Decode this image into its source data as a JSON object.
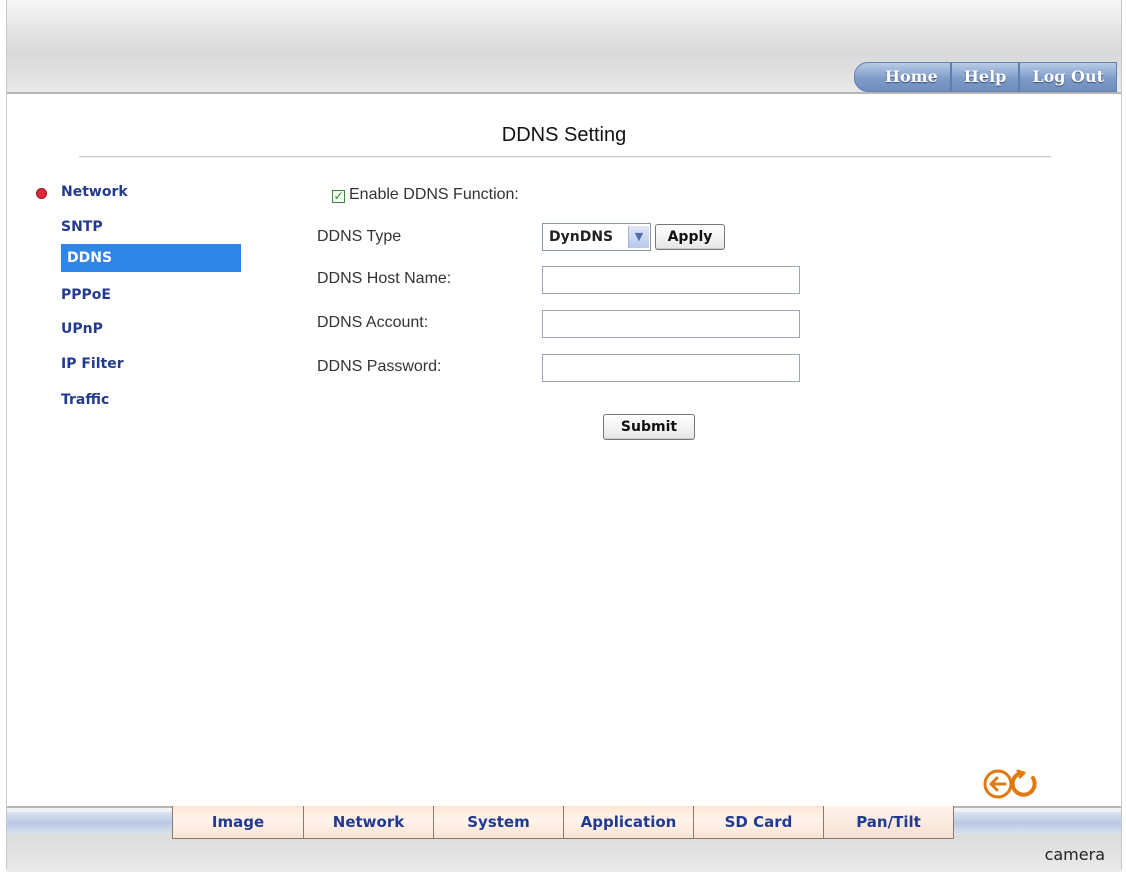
{
  "header": {
    "nav": [
      "Home",
      "Help",
      "Log Out"
    ]
  },
  "page": {
    "title": "DDNS Setting"
  },
  "sidebar": {
    "items": [
      {
        "label": "Network",
        "active": false
      },
      {
        "label": "SNTP",
        "active": false
      },
      {
        "label": "DDNS",
        "active": true
      },
      {
        "label": "PPPoE",
        "active": false
      },
      {
        "label": "UPnP",
        "active": false
      },
      {
        "label": "IP Filter",
        "active": false
      },
      {
        "label": "Traffic",
        "active": false
      }
    ]
  },
  "form": {
    "enable_label": "Enable DDNS Function:",
    "enable_checked": true,
    "type_label": "DDNS Type",
    "type_value": "DynDNS",
    "apply_label": "Apply",
    "host_label": "DDNS Host Name:",
    "host_value": "",
    "account_label": "DDNS Account:",
    "account_value": "",
    "password_label": "DDNS Password:",
    "password_value": "",
    "submit_label": "Submit"
  },
  "bottom_tabs": [
    "Image",
    "Network",
    "System",
    "Application",
    "SD Card",
    "Pan/Tilt"
  ],
  "footer": {
    "brand": "camera"
  },
  "icons": [
    "back-arrow-icon",
    "refresh-icon"
  ],
  "colors": {
    "active_nav": "#2f86e6",
    "link": "#223a8f",
    "icon_orange": "#e07a10",
    "bullet": "#d72c3a"
  }
}
